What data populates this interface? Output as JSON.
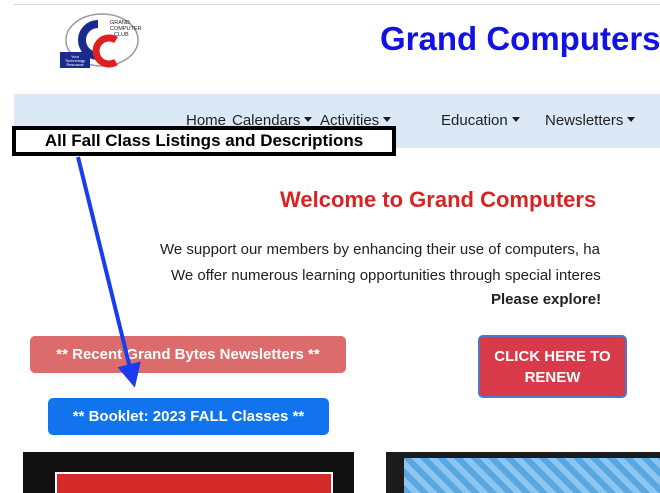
{
  "header": {
    "site_title": "Grand Computers",
    "logo": {
      "top_text": "GRAND COMPUTERS CLUB",
      "badge_text": "Your Technology Resource",
      "colors": {
        "navy": "#1a2b8f",
        "red": "#e02020",
        "grey": "#9a9a9a"
      }
    }
  },
  "nav": {
    "items": [
      {
        "label": "Home",
        "has_dropdown": false
      },
      {
        "label": "Calendars",
        "has_dropdown": true
      },
      {
        "label": "Activities",
        "has_dropdown": true
      },
      {
        "label": "Education",
        "has_dropdown": true
      },
      {
        "label": "Newsletters",
        "has_dropdown": true
      }
    ]
  },
  "callout": {
    "label": "All Fall Class Listings and Descriptions"
  },
  "main": {
    "welcome": "Welcome to Grand Computers",
    "para_line1": "We support our members by enhancing their use of computers, ha",
    "para_line2": "We offer numerous learning opportunities through special interes",
    "para_line3": "Please explore!",
    "buttons": {
      "newsletters": "** Recent Grand Bytes Newsletters **",
      "renew_line1": "CLICK HERE TO",
      "renew_line2": "RENEW",
      "booklet": "** Booklet: 2023 FALL Classes **"
    }
  },
  "colors": {
    "title_blue": "#1212e6",
    "welcome_red": "#d92323",
    "nav_bg": "#dbe9f7",
    "arrow_blue": "#1a3cf0",
    "booklet_blue": "#1174ee"
  }
}
